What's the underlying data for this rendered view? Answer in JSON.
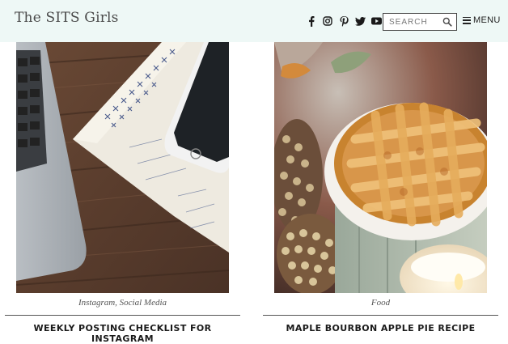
{
  "header": {
    "site_title": "The SITS Girls",
    "social_icons": [
      "facebook-icon",
      "instagram-icon",
      "pinterest-icon",
      "twitter-icon",
      "youtube-icon"
    ],
    "search": {
      "placeholder": "SEARCH"
    },
    "menu_label": "MENU"
  },
  "posts": [
    {
      "category": "Instagram, Social Media",
      "title": "WEEKLY POSTING CHECKLIST FOR INSTAGRAM",
      "image": "laptop-checklist-phone-photo"
    },
    {
      "category": "Food",
      "title": "MAPLE BOURBON APPLE PIE RECIPE",
      "image": "apple-pie-photo"
    }
  ],
  "colors": {
    "header_bg": "#eef8f6",
    "text": "#1a1a1a",
    "rule": "#555555"
  }
}
